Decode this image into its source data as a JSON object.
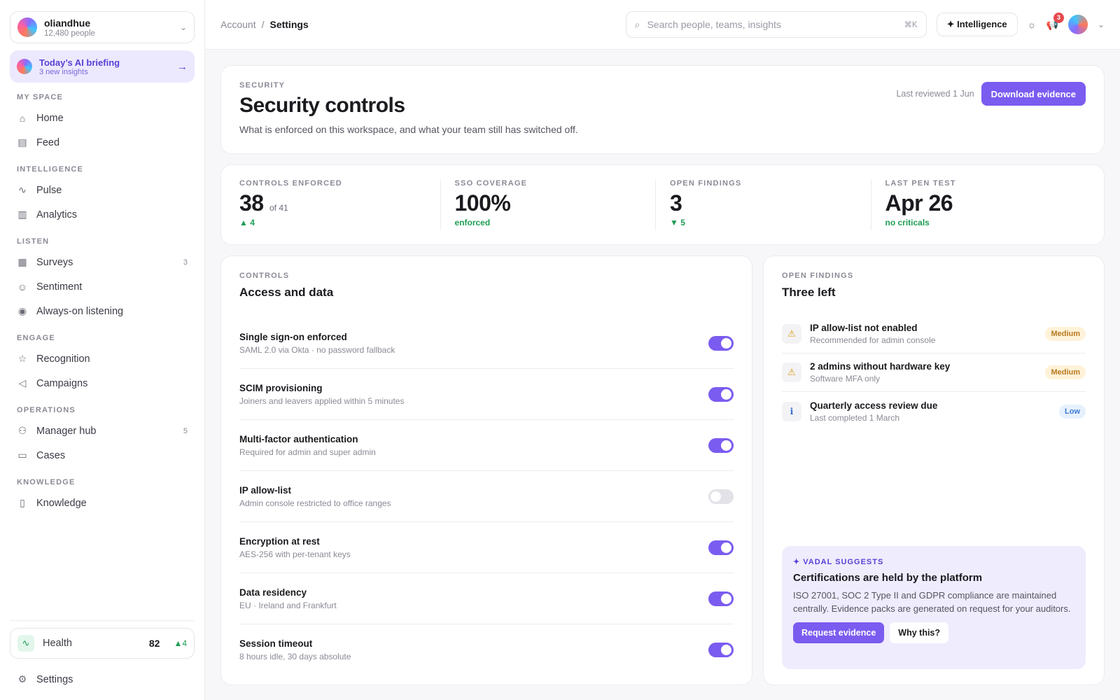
{
  "workspace": {
    "name": "oliandhue",
    "sub": "12,480 people"
  },
  "briefing": {
    "title": "Today’s AI briefing",
    "sub": "3 new insights"
  },
  "sidebar": {
    "sections": [
      {
        "label": "MY SPACE",
        "items": [
          {
            "label": "Home",
            "icon": "home-icon"
          },
          {
            "label": "Feed",
            "icon": "feed-icon"
          }
        ]
      },
      {
        "label": "INTELLIGENCE",
        "items": [
          {
            "label": "Pulse",
            "icon": "pulse-icon"
          },
          {
            "label": "Analytics",
            "icon": "analytics-icon"
          }
        ]
      },
      {
        "label": "LISTEN",
        "items": [
          {
            "label": "Surveys",
            "icon": "survey-icon",
            "count": "3"
          },
          {
            "label": "Sentiment",
            "icon": "smile-icon"
          },
          {
            "label": "Always-on listening",
            "icon": "broadcast-icon"
          }
        ]
      },
      {
        "label": "ENGAGE",
        "items": [
          {
            "label": "Recognition",
            "icon": "star-icon"
          },
          {
            "label": "Campaigns",
            "icon": "megaphone-icon"
          }
        ]
      },
      {
        "label": "OPERATIONS",
        "items": [
          {
            "label": "Manager hub",
            "icon": "people-icon",
            "count": "5"
          },
          {
            "label": "Cases",
            "icon": "briefcase-icon"
          }
        ]
      },
      {
        "label": "KNOWLEDGE",
        "items": [
          {
            "label": "Knowledge",
            "icon": "book-icon"
          }
        ]
      }
    ],
    "health": {
      "label": "Health",
      "score": "82",
      "delta": "▲4"
    },
    "settings": "Settings"
  },
  "topbar": {
    "breadcrumb": [
      "Account",
      "/",
      "Settings"
    ],
    "search_placeholder": "Search people, teams, insights",
    "search_kbd": "⌘K",
    "intelligence_label": "✦ Intelligence",
    "notif_count": "3"
  },
  "hero": {
    "eyebrow": "SECURITY",
    "title": "Security controls",
    "desc": "What is enforced on this workspace, and what your team still has switched off.",
    "reviewed": "Last reviewed 1 Jun",
    "download_label": "Download evidence"
  },
  "stats": [
    {
      "label": "CONTROLS ENFORCED",
      "value": "38",
      "suffix": "of 41",
      "delta": "▲ 4"
    },
    {
      "label": "SSO COVERAGE",
      "value": "100%",
      "suffix": "",
      "delta": "enforced"
    },
    {
      "label": "OPEN FINDINGS",
      "value": "3",
      "suffix": "",
      "delta": "▼ 5"
    },
    {
      "label": "LAST PEN TEST",
      "value": "Apr 26",
      "suffix": "",
      "delta": "no criticals"
    }
  ],
  "controls": {
    "eyebrow": "CONTROLS",
    "title": "Access and data",
    "items": [
      {
        "title": "Single sign-on enforced",
        "sub": "SAML 2.0 via Okta · no password fallback",
        "on": true
      },
      {
        "title": "SCIM provisioning",
        "sub": "Joiners and leavers applied within 5 minutes",
        "on": true
      },
      {
        "title": "Multi-factor authentication",
        "sub": "Required for admin and super admin",
        "on": true
      },
      {
        "title": "IP allow-list",
        "sub": "Admin console restricted to office ranges",
        "on": false
      },
      {
        "title": "Encryption at rest",
        "sub": "AES-256 with per-tenant keys",
        "on": true
      },
      {
        "title": "Data residency",
        "sub": "EU · Ireland and Frankfurt",
        "on": true
      },
      {
        "title": "Session timeout",
        "sub": "8 hours idle, 30 days absolute",
        "on": true
      }
    ]
  },
  "findings": {
    "eyebrow": "OPEN FINDINGS",
    "title": "Three left",
    "items": [
      {
        "title": "IP allow-list not enabled",
        "sub": "Recommended for admin console",
        "severity": "Medium",
        "icon": "warning-icon"
      },
      {
        "title": "2 admins without hardware key",
        "sub": "Software MFA only",
        "severity": "Medium",
        "icon": "warning-icon"
      },
      {
        "title": "Quarterly access review due",
        "sub": "Last completed 1 March",
        "severity": "Low",
        "icon": "info-icon"
      }
    ]
  },
  "suggestion": {
    "tag": "✦ VADAL SUGGESTS",
    "title": "Certifications are held by the platform",
    "body": "ISO 27001, SOC 2 Type II and GDPR compliance are maintained centrally. Evidence packs are generated on request for your auditors.",
    "primary": "Request evidence",
    "secondary": "Why this?"
  },
  "colors": {
    "accent": "#7b5cf0",
    "positive": "#1f9d55",
    "medium": "#b7791f",
    "low": "#3d7bd6"
  }
}
